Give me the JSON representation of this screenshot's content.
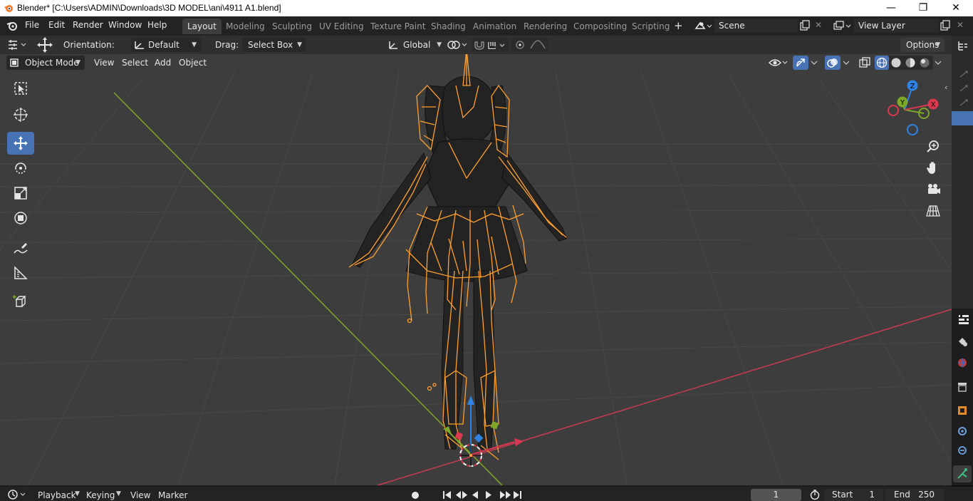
{
  "window": {
    "title": "Blender* [C:\\Users\\ADMIN\\Downloads\\3D MODEL\\ani\\4911 A1.blend]",
    "minimize": "—",
    "maximize": "❐",
    "close": "✕"
  },
  "menu": [
    "File",
    "Edit",
    "Render",
    "Window",
    "Help"
  ],
  "workspaces": [
    {
      "label": "Layout",
      "active": true
    },
    {
      "label": "Modeling"
    },
    {
      "label": "Sculpting"
    },
    {
      "label": "UV Editing"
    },
    {
      "label": "Texture Paint"
    },
    {
      "label": "Shading"
    },
    {
      "label": "Animation"
    },
    {
      "label": "Rendering"
    },
    {
      "label": "Compositing"
    },
    {
      "label": "Scripting"
    }
  ],
  "add_workspace": "+",
  "scene": {
    "value": "Scene"
  },
  "view_layer": {
    "value": "View Layer"
  },
  "tool_header": {
    "orientation_label": "Orientation:",
    "orientation_value": "Default",
    "drag_label": "Drag:",
    "drag_value": "Select Box",
    "transform_orientation": "Global",
    "options": "Options"
  },
  "view_header": {
    "mode": "Object Mode",
    "menus": [
      "View",
      "Select",
      "Add",
      "Object"
    ]
  },
  "timeline": {
    "menus": [
      "Playback",
      "Keying",
      "View",
      "Marker"
    ],
    "current_frame": "1",
    "start_label": "Start",
    "start_value": "1",
    "end_label": "End",
    "end_value": "250"
  },
  "gizmo_axes": {
    "x": "X",
    "y": "Y",
    "z": "Z"
  },
  "colors": {
    "accent": "#4772b3",
    "selection": "#ff9f2d",
    "x_axis": "#d9384e",
    "y_axis": "#7ea628",
    "z_axis": "#2f84e3"
  }
}
